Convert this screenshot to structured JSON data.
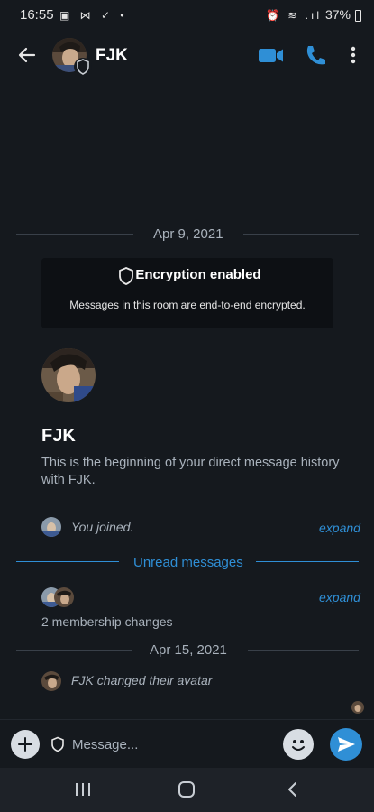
{
  "status_bar": {
    "time": "16:55",
    "left_icons": "▣ ⋈ ✓ •",
    "right_icons": "⏰ ≋ .ıl",
    "battery": "37%"
  },
  "header": {
    "room_name": "FJK",
    "accent_color": "#2f8fd6"
  },
  "timeline": {
    "date_1": "Apr 9, 2021",
    "encryption_title": "Encryption enabled",
    "encryption_desc": "Messages in this room are end-to-end encrypted.",
    "room_heading": "FJK",
    "room_intro": "This is the beginning of your direct message history with FJK.",
    "joined_event": "You joined.",
    "expand_label_1": "expand",
    "unread_label": "Unread messages",
    "expand_label_2": "expand",
    "membership_changes": "2 membership changes",
    "date_2": "Apr 15, 2021",
    "avatar_change_event": "FJK changed their avatar"
  },
  "composer": {
    "placeholder": "Message..."
  },
  "nav_bar": {
    "icons": [
      "recent-apps-icon",
      "home-icon",
      "back-icon"
    ]
  }
}
